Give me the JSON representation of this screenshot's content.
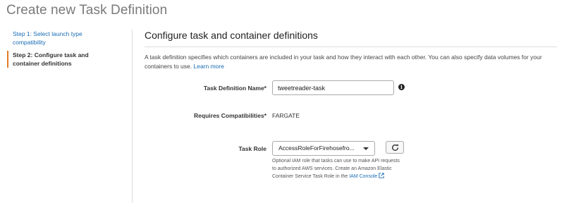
{
  "page": {
    "title": "Create new Task Definition"
  },
  "sidebar": {
    "steps": [
      {
        "label_line1": "Step 1: Select launch type",
        "label_line2": "compatibility"
      },
      {
        "label_line1": "Step 2: Configure task and",
        "label_line2": "container definitions"
      }
    ]
  },
  "main": {
    "section_title": "Configure task and container definitions",
    "description": "A task definition specifies which containers are included in your task and how they interact with each other. You can also specify data volumes for your containers to use.",
    "learn_more": "Learn more"
  },
  "form": {
    "task_definition_name": {
      "label": "Task Definition Name*",
      "value": "tweetreader-task",
      "info_icon": "info-icon"
    },
    "requires_compatibilities": {
      "label": "Requires Compatibilities*",
      "value": "FARGATE"
    },
    "task_role": {
      "label": "Task Role",
      "selected": "AccessRoleForFirehosefro...",
      "refresh_icon": "refresh-icon",
      "helper_text": "Optional IAM role that tasks can use to make API requests to authorized AWS services. Create an Amazon Elastic Container Service Task Role in the",
      "helper_link": "IAM Console"
    }
  },
  "colors": {
    "link": "#1a6cb5",
    "active_step_marker": "#e07b25"
  }
}
